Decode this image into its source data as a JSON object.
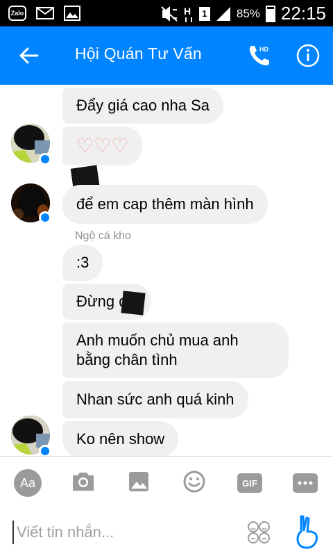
{
  "status_bar": {
    "battery": "85%",
    "time": "22:15",
    "sim": "1",
    "app_icon": "Zalo"
  },
  "header": {
    "title": "Hội Quán Tư Vấn",
    "call_badge": "HD"
  },
  "messages": [
    {
      "text": "Đẩy giá cao nha Sa"
    },
    {
      "text": "♡♡♡"
    },
    {
      "text": "để em cap thêm màn hình"
    },
    {
      "sender": "Ngộ cá kho"
    },
    {
      "text": ":3"
    },
    {
      "text": "Đừng q"
    },
    {
      "text": "Anh muốn chủ mua anh bằng chân tình"
    },
    {
      "text": "Nhan sức anh quá kinh"
    },
    {
      "text": "Ko nên show"
    }
  ],
  "composer": {
    "aa_label": "Aa",
    "gif_label": "GIF",
    "placeholder": "Viết tin nhắn..."
  },
  "colors": {
    "accent": "#0084ff",
    "bubble": "#f0f0f0",
    "heart": "#f4a9a8"
  }
}
